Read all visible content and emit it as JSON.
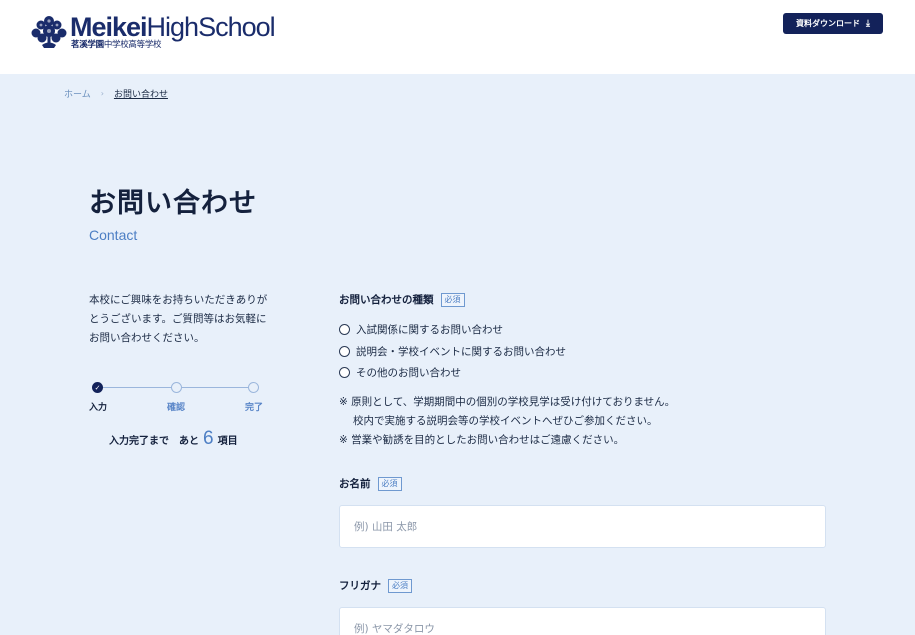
{
  "header": {
    "logo": {
      "brand_bold": "Meikei",
      "brand_light": "HighSchool",
      "sub_bold": "茗溪学園",
      "sub_light": "中学校高等学校"
    },
    "download_button": "資料ダウンロード"
  },
  "breadcrumb": {
    "home": "ホーム",
    "separator": "›",
    "current": "お問い合わせ"
  },
  "page": {
    "title": "お問い合わせ",
    "subtitle": "Contact"
  },
  "intro": "本校にご興味をお持ちいただきありがとうございます。ご質問等はお気軽にお問い合わせください。",
  "progress": {
    "steps": [
      "入力",
      "確認",
      "完了"
    ],
    "current_step": 1,
    "remaining_prefix": "入力完了まで　あと",
    "remaining_count": "6",
    "remaining_suffix": "項目"
  },
  "form": {
    "required_badge": "必須",
    "inquiry_type": {
      "label": "お問い合わせの種類",
      "options": [
        "入試関係に関するお問い合わせ",
        "説明会・学校イベントに関するお問い合わせ",
        "その他のお問い合わせ"
      ]
    },
    "notes": [
      "※ 原則として、学期期間中の個別の学校見学は受け付けておりません。",
      "校内で実施する説明会等の学校イベントへぜひご参加ください。",
      "※ 営業や勧誘を目的としたお問い合わせはご遠慮ください。"
    ],
    "name": {
      "label": "お名前",
      "placeholder": "例) 山田 太郎",
      "value": ""
    },
    "kana": {
      "label": "フリガナ",
      "placeholder": "例) ヤマダタロウ",
      "value": ""
    }
  },
  "colors": {
    "brand_navy": "#13225a",
    "accent_blue": "#4d7fc4",
    "background": "#e8f0fa"
  }
}
